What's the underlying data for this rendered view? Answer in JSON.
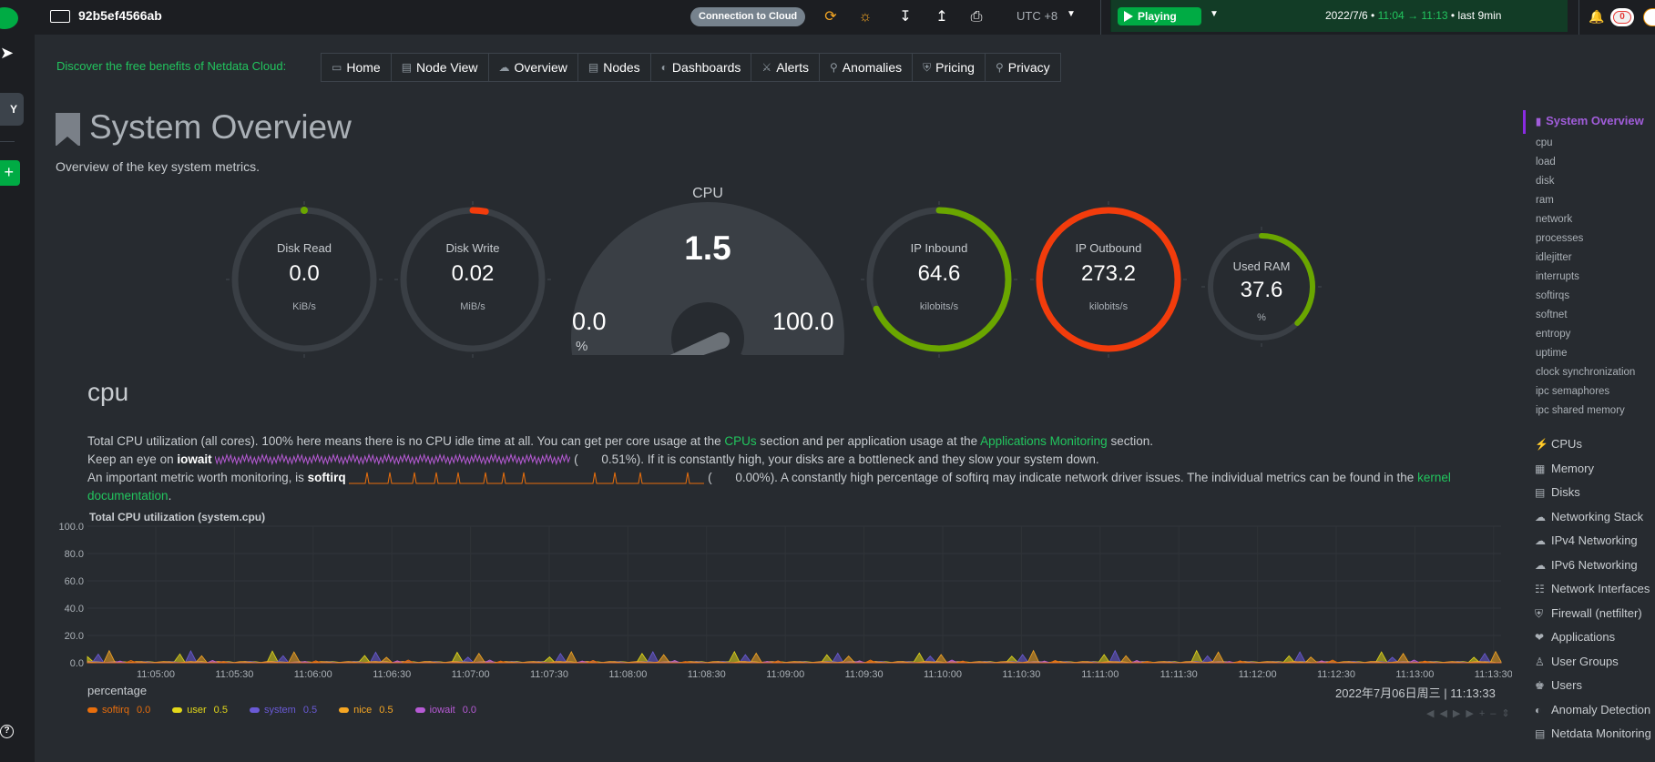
{
  "topbar": {
    "hostname": "92b5ef4566ab",
    "connection_label": "Connection to Cloud",
    "timezone": "UTC +8",
    "play_label": "Playing",
    "range_date": "2022/7/6 •",
    "range_start": "11:04",
    "range_end": "11:13",
    "range_suffix": "• last 9min",
    "notification_count": "0",
    "space_initial": "Y",
    "add_label": "+",
    "help_label": "?"
  },
  "nav": {
    "promo": "Discover the free benefits of Netdata Cloud:",
    "items": [
      {
        "label": "Home",
        "icon": "monitor-icon"
      },
      {
        "label": "Node View",
        "icon": "node-view-icon"
      },
      {
        "label": "Overview",
        "icon": "overview-icon"
      },
      {
        "label": "Nodes",
        "icon": "nodes-icon"
      },
      {
        "label": "Dashboards",
        "icon": "dashboard-icon"
      },
      {
        "label": "Alerts",
        "icon": "bell-icon"
      },
      {
        "label": "Anomalies",
        "icon": "anomaly-icon"
      },
      {
        "label": "Pricing",
        "icon": "shield-icon"
      },
      {
        "label": "Privacy",
        "icon": "lock-icon"
      }
    ]
  },
  "header": {
    "title": "System Overview",
    "subtitle": "Overview of the key system metrics."
  },
  "dials": [
    {
      "label": "Disk Read",
      "value": "0.0",
      "unit": "KiB/s",
      "fraction": 0.0,
      "color": "#6aa600"
    },
    {
      "label": "Disk Write",
      "value": "0.02",
      "unit": "MiB/s",
      "fraction": 0.03,
      "color": "#f23c0c"
    },
    {
      "label": "IP Inbound",
      "value": "64.6",
      "unit": "kilobits/s",
      "fraction": 0.68,
      "color": "#6aa600"
    },
    {
      "label": "IP Outbound",
      "value": "273.2",
      "unit": "kilobits/s",
      "fraction": 1.0,
      "color": "#f23c0c"
    },
    {
      "label": "Used RAM",
      "value": "37.6",
      "unit": "%",
      "fraction": 0.376,
      "color": "#6aa600"
    }
  ],
  "cpu_gauge": {
    "title": "CPU",
    "value": "1.5",
    "min": "0.0",
    "max": "100.0",
    "unit": "%",
    "fraction": 0.015
  },
  "cpu_section": {
    "title": "cpu",
    "p1_a": "Total CPU utilization (all cores). 100% here means there is no CPU idle time at all. You can get per core usage at the",
    "p1_link1": "CPUs",
    "p1_b": "section and per application usage at the",
    "p1_link2": "Applications Monitoring",
    "p1_c": "section.",
    "p2_a": "Keep an eye on",
    "p2_bold": "iowait",
    "p2_val": "0.51%",
    "p2_b": "). If it is constantly high, your disks are a bottleneck and they slow your system down.",
    "p3_a": "An important metric worth monitoring, is",
    "p3_bold": "softirq",
    "p3_val": "0.00%",
    "p3_b": "). A constantly high percentage of softirq may indicate network driver issues. The individual metrics can be found in the",
    "p3_link": "kernel",
    "p4_link": "documentation",
    "p4_end": "."
  },
  "chart": {
    "title": "Total CPU utilization (system.cpu)",
    "unit_label": "percentage",
    "timestamp": "2022年7月06日周三 | 11:13:33",
    "legend": [
      {
        "name": "softirq",
        "value": "0.0",
        "color": "#e86e0c"
      },
      {
        "name": "user",
        "value": "0.5",
        "color": "#e3d81a"
      },
      {
        "name": "system",
        "value": "0.5",
        "color": "#6a5ad6"
      },
      {
        "name": "nice",
        "value": "0.5",
        "color": "#f5a623"
      },
      {
        "name": "iowait",
        "value": "0.0",
        "color": "#b65ad4"
      }
    ]
  },
  "chart_data": {
    "type": "area",
    "title": "Total CPU utilization (system.cpu)",
    "ylabel": "percentage",
    "ylim": [
      0,
      100
    ],
    "y_ticks": [
      "100.0",
      "80.0",
      "60.0",
      "40.0",
      "20.0",
      "0.0"
    ],
    "x_ticks": [
      "11:05:00",
      "11:05:30",
      "11:06:00",
      "11:06:30",
      "11:07:00",
      "11:07:30",
      "11:08:00",
      "11:08:30",
      "11:09:00",
      "11:09:30",
      "11:10:00",
      "11:10:30",
      "11:11:00",
      "11:11:30",
      "11:12:00",
      "11:12:30",
      "11:13:00",
      "11:13:30"
    ],
    "series": [
      {
        "name": "user",
        "approx_value": 0.5
      },
      {
        "name": "system",
        "approx_value": 0.5
      },
      {
        "name": "nice",
        "approx_value": 0.5
      },
      {
        "name": "iowait",
        "approx_value": 0.0
      },
      {
        "name": "softirq",
        "approx_value": 0.0
      }
    ]
  },
  "sidebar": {
    "title": "System Overview",
    "sub_items": [
      "cpu",
      "load",
      "disk",
      "ram",
      "network",
      "processes",
      "idlejitter",
      "interrupts",
      "softirqs",
      "softnet",
      "entropy",
      "uptime",
      "clock synchronization",
      "ipc semaphores",
      "ipc shared memory"
    ],
    "sections": [
      {
        "label": "CPUs",
        "icon": "bolt-icon"
      },
      {
        "label": "Memory",
        "icon": "memory-icon"
      },
      {
        "label": "Disks",
        "icon": "disk-icon"
      },
      {
        "label": "Networking Stack",
        "icon": "cloud-icon"
      },
      {
        "label": "IPv4 Networking",
        "icon": "cloud-icon"
      },
      {
        "label": "IPv6 Networking",
        "icon": "cloud-icon"
      },
      {
        "label": "Network Interfaces",
        "icon": "network-icon"
      },
      {
        "label": "Firewall (netfilter)",
        "icon": "shield-icon"
      },
      {
        "label": "Applications",
        "icon": "heartbeat-icon"
      },
      {
        "label": "User Groups",
        "icon": "user-icon"
      },
      {
        "label": "Users",
        "icon": "users-icon"
      },
      {
        "label": "Anomaly Detection",
        "icon": "anomaly-icon"
      },
      {
        "label": "Netdata Monitoring",
        "icon": "chart-icon"
      }
    ]
  }
}
